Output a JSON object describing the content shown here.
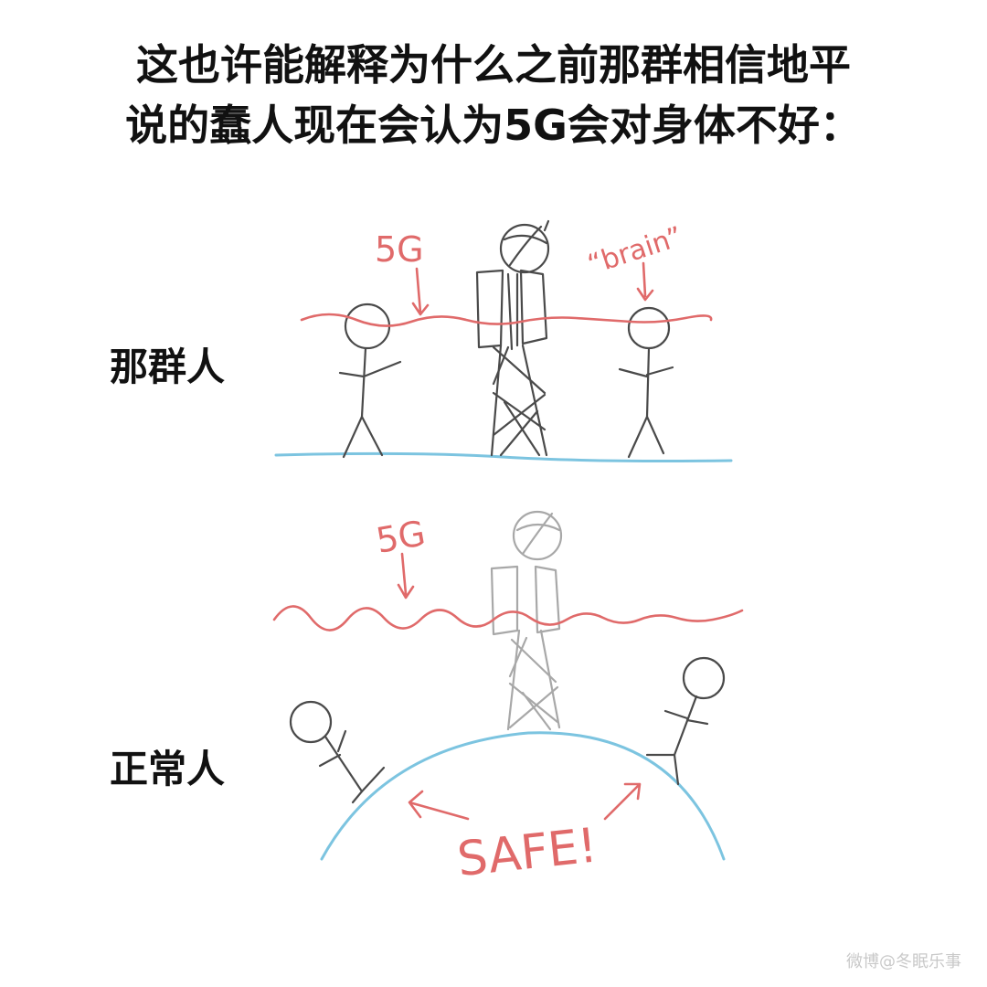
{
  "caption": {
    "line1": "这也许能解释为什么之前那群相信地平",
    "line2": "说的蠢人现在会认为5G会对身体不好："
  },
  "labels": {
    "top": "那群人",
    "bottom": "正常人"
  },
  "drawing": {
    "top_5g": "5G",
    "top_brain": "“brain”",
    "bottom_5g": "5G",
    "safe": "SAFE!"
  },
  "watermark": "微博@冬眠乐事",
  "colors": {
    "wave": "#e06a6a",
    "ground": "#7cc4e0",
    "pencil": "#4a4a4a"
  }
}
